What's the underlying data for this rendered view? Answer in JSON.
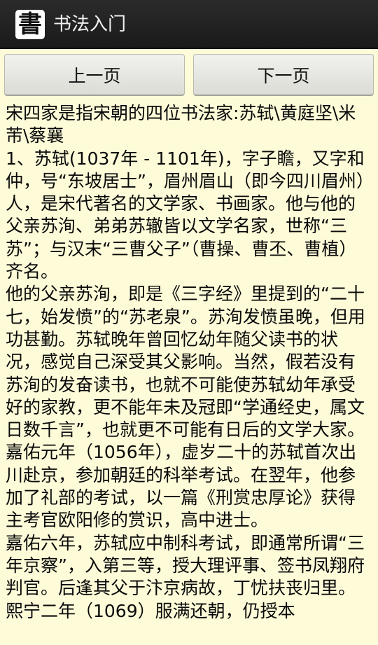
{
  "app": {
    "icon_glyph": "書",
    "title": "书法入门"
  },
  "nav": {
    "prev_label": "上一页",
    "next_label": "下一页"
  },
  "article": {
    "paragraphs": [
      "宋四家是指宋朝的四位书法家:苏轼\\黄庭坚\\米芾\\蔡襄",
      "",
      "1、苏轼(1037年 - 1101年)，字子瞻，又字和仲，号“东坡居士”，眉州眉山（即今四川眉州）人，是宋代著名的文学家、书画家。他与他的父亲苏洵、弟弟苏辙皆以文学名家，世称“三苏”；与汉末“三曹父子”（曹操、曹丕、曹植）齐名。",
      "他的父亲苏洵，即是《三字经》里提到的“二十七，始发愤”的“苏老泉”。苏洵发愤虽晚，但用功甚勤。苏轼晚年曾回忆幼年随父读书的状况，感觉自己深受其父影响。当然，假若没有苏洵的发奋读书，也就不可能使苏轼幼年承受好的家教，更不能年未及冠即“学通经史，属文日数千言”，也就更不可能有日后的文学大家。",
      "嘉佑元年（1056年），虚岁二十的苏轼首次出川赴京，参加朝廷的科举考试。在翌年，他参加了礼部的考试，以一篇《刑赏忠厚论》获得主考官欧阳修的赏识，高中进士。",
      "嘉佑六年，苏轼应中制科考试，即通常所谓“三年京察”，入第三等，授大理评事、签书凤翔府判官。后逢其父于汴京病故，丁忧扶丧归里。熙宁二年（1069）服满还朝，仍授本"
    ]
  }
}
